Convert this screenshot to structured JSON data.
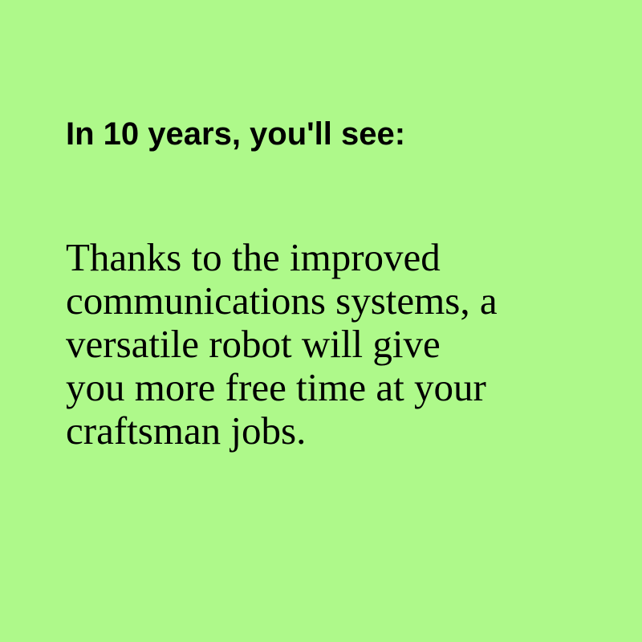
{
  "colors": {
    "background": "#aef98a",
    "text": "#000000"
  },
  "heading": "In 10 years, you'll see:",
  "body_lines": [
    "Thanks to the improved",
    "communications systems, a",
    "versatile robot will give",
    "you more free time at your",
    "craftsman jobs."
  ]
}
